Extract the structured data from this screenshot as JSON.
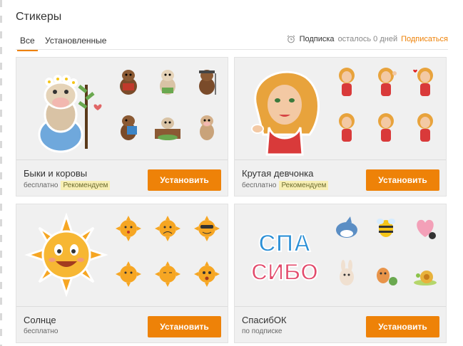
{
  "page": {
    "title": "Стикеры"
  },
  "tabs": [
    {
      "label": "Все",
      "active": true
    },
    {
      "label": "Установленные",
      "active": false
    }
  ],
  "subscription": {
    "label": "Подписка",
    "remaining": "осталось 0 дней",
    "action": "Подписаться",
    "icon": "alarm-clock-icon"
  },
  "colors": {
    "accent": "#ee8208",
    "card_bg": "#f0f0f0",
    "badge_bg": "#f8efb4"
  },
  "packs": [
    {
      "name": "Быки и коровы",
      "price": "бесплатно",
      "badge": "Рекомендуем",
      "button": "Установить"
    },
    {
      "name": "Крутая девчонка",
      "price": "бесплатно",
      "badge": "Рекомендуем",
      "button": "Установить"
    },
    {
      "name": "Солнце",
      "price": "бесплатно",
      "badge": "",
      "button": "Установить"
    },
    {
      "name": "СпасибОК",
      "price": "по подписке",
      "badge": "",
      "button": "Установить",
      "hero_text": [
        "СПА",
        "СИБО"
      ]
    }
  ]
}
